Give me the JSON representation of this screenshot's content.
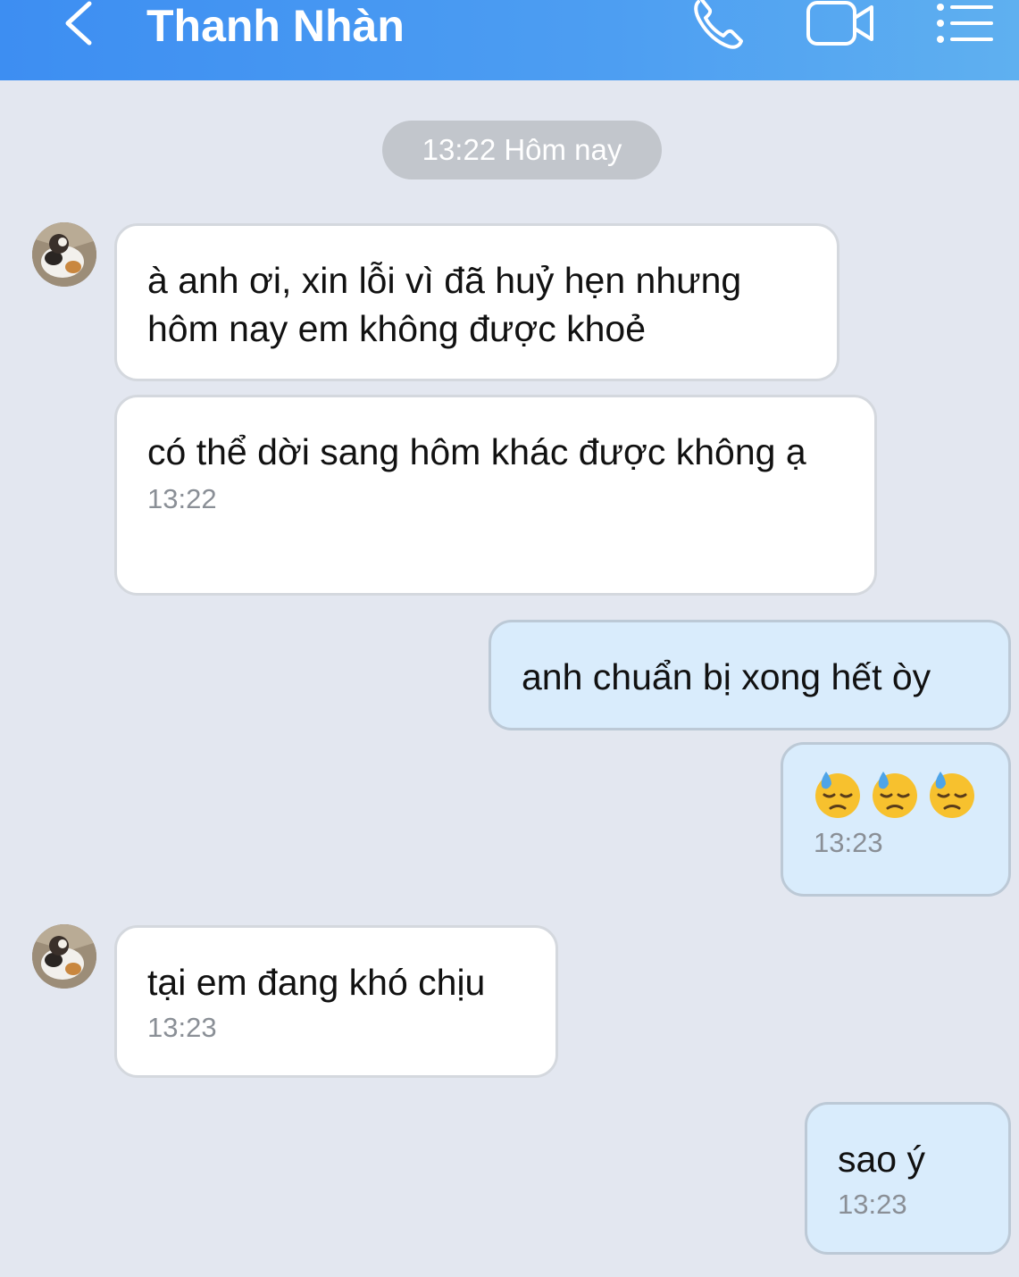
{
  "header": {
    "contact_name": "Thanh Nhàn",
    "icons": [
      "back-chevron-icon",
      "phone-icon",
      "video-camera-icon",
      "menu-list-icon"
    ],
    "gradient_colors": [
      "#3d8ef2",
      "#5fb0f0"
    ]
  },
  "conversation": {
    "date_separator": "13:22 Hôm nay",
    "messages": [
      {
        "direction": "incoming",
        "text": "à anh ơi, xin lỗi vì đã huỷ hẹn nhưng hôm nay em không được khoẻ",
        "time": ""
      },
      {
        "direction": "incoming",
        "text": "có thể dời sang hôm khác được không ạ",
        "time": "13:22"
      },
      {
        "direction": "outgoing",
        "text": "anh chuẩn bị xong hết òy",
        "time": ""
      },
      {
        "direction": "outgoing",
        "text": "😓😓😓",
        "emoji": "downcast-face-with-sweat",
        "count": 3,
        "time": "13:23"
      },
      {
        "direction": "incoming",
        "text": "tại em đang khó chịu",
        "time": "13:23"
      },
      {
        "direction": "outgoing",
        "text": "sao ý",
        "time": "13:23"
      }
    ]
  },
  "colors": {
    "background": "#e3e7f0",
    "incoming_bubble": "#ffffff",
    "outgoing_bubble": "#d9ecfc",
    "timestamp": "#8a8f96"
  }
}
